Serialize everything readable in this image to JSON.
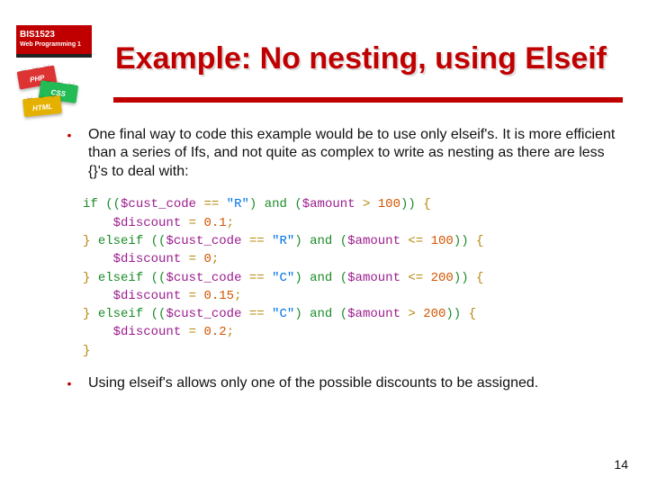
{
  "course": {
    "code": "BIS1523",
    "name": "Web Programming 1"
  },
  "blocks": {
    "php": "PHP",
    "css": "CSS",
    "html": "HTML"
  },
  "title": "Example: No nesting, using Elseif",
  "bullets": {
    "b1": "One final way to code this example would be to use only elseif's. It is more efficient than a series of Ifs, and not quite as complex to write as nesting as there are less {}'s to deal with:",
    "b2": "Using elseif's allows only one of the possible discounts to be assigned."
  },
  "code": {
    "kw_if": "if",
    "kw_elseif": "elseif",
    "kw_and": "and",
    "var_cust": "$cust_code",
    "var_amount": "$amount",
    "var_discount": "$discount",
    "str_R": "\"R\"",
    "str_C": "\"C\"",
    "n100": "100",
    "n200": "200",
    "d01": "0.1",
    "d00": "0",
    "d015": "0.15",
    "d02": "0.2"
  },
  "page_number": "14"
}
